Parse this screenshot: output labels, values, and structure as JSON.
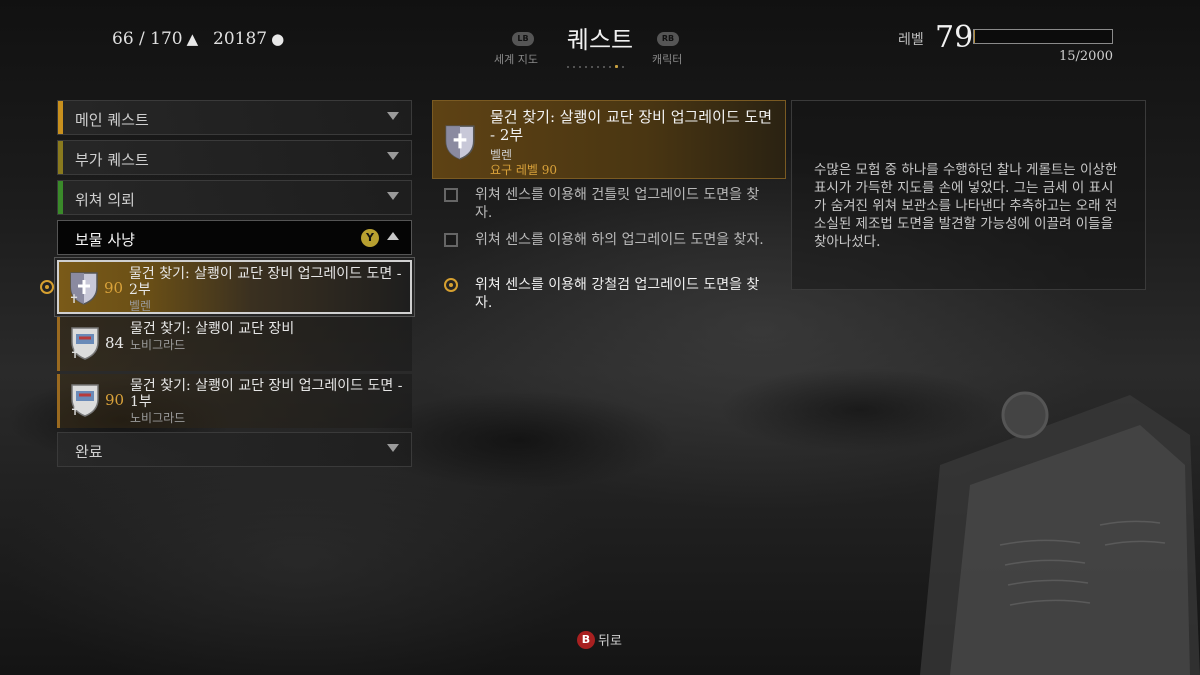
{
  "header": {
    "stats": {
      "weight": "66 / 170",
      "money": "20187"
    },
    "title": "퀘스트",
    "left_nav": {
      "button": "LB",
      "label": "세계 지도"
    },
    "right_nav": {
      "button": "RB",
      "label": "캐릭터"
    },
    "level_label": "레벨",
    "level": "79",
    "xp_text": "15/2000",
    "xp_progress": 0.0075
  },
  "categories": [
    {
      "label": "메인 퀘스트",
      "color": "#c8901e"
    },
    {
      "label": "부가 퀘스트",
      "color": "#8a7a1e"
    },
    {
      "label": "위쳐 의뢰",
      "color": "#3a8a2a"
    },
    {
      "label": "보물 사냥",
      "button": "Y"
    },
    {
      "label": "완료"
    }
  ],
  "quests": [
    {
      "level": "90",
      "title": "물건 찾기: 살쾡이 교단 장비 업그레이드 도면 - 2부",
      "region": "벨렌",
      "level_color": "#d9a23a",
      "icon": "griffin-shield-icon",
      "tracked": true
    },
    {
      "level": "84",
      "title": "물건 찾기: 살쾡이 교단 장비",
      "region": "노비그라드",
      "level_color": "#e8e8e8",
      "icon": "novigrad-shield-icon",
      "tracked": false
    },
    {
      "level": "90",
      "title": "물건 찾기: 살쾡이 교단 장비 업그레이드 도면 - 1부",
      "region": "노비그라드",
      "level_color": "#d9a23a",
      "icon": "novigrad-shield-icon",
      "tracked": false
    }
  ],
  "detail": {
    "title": "물건 찾기: 살쾡이 교단 장비 업그레이드 도면 - 2부",
    "region": "벨렌",
    "requirement": "요구 레벨 90",
    "objectives": [
      {
        "text": "위쳐 센스를 이용해 건틀릿 업그레이드 도면을 찾자.",
        "active": false
      },
      {
        "text": "위쳐 센스를 이용해 하의 업그레이드 도면을 찾자.",
        "active": false
      },
      {
        "text": "위쳐 센스를 이용해 강철검 업그레이드 도면을 찾자.",
        "active": true
      }
    ],
    "description": "수많은 모험 중 하나를 수행하던 찰나 게롤트는 이상한 표시가 가득한 지도를 손에 넣었다. 그는 금세 이 표시가 숨겨진 위쳐 보관소를 나타낸다 추측하고는 오래 전 소실된 제조법 도면을 발견할 가능성에 이끌려 이들을 찾아나섰다."
  },
  "footer": {
    "button": "B",
    "label": "뒤로"
  }
}
